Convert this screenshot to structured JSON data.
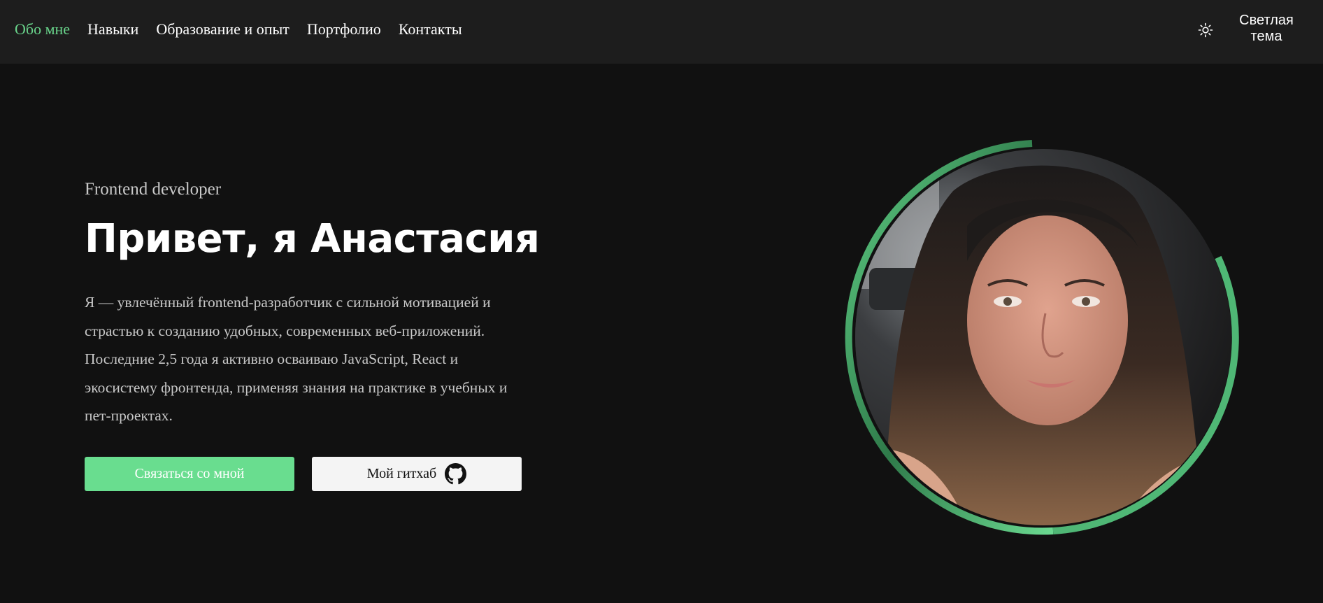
{
  "nav": {
    "items": [
      {
        "label": "Обо мне",
        "active": true
      },
      {
        "label": "Навыки",
        "active": false
      },
      {
        "label": "Образование и опыт",
        "active": false
      },
      {
        "label": "Портфолио",
        "active": false
      },
      {
        "label": "Контакты",
        "active": false
      }
    ]
  },
  "theme_toggle": {
    "icon": "sun-icon",
    "label": "Светлая тема"
  },
  "hero": {
    "role": "Frontend developer",
    "title": "Привет, я Анастасия",
    "bio": "Я — увлечённый frontend-разработчик с сильной мотивацией и страстью к созданию удобных, современных веб-приложений. Последние 2,5 года я активно осваиваю JavaScript, React и экосистему фронтенда, применяя знания на практике в учебных и пет-проектах.",
    "contact_button": "Связаться со мной",
    "github_button": "Мой гитхаб",
    "github_icon": "github-icon"
  },
  "avatar": {
    "icon": "profile-photo"
  },
  "colors": {
    "accent": "#69d48b",
    "background": "#111111",
    "header": "#1d1d1d"
  }
}
